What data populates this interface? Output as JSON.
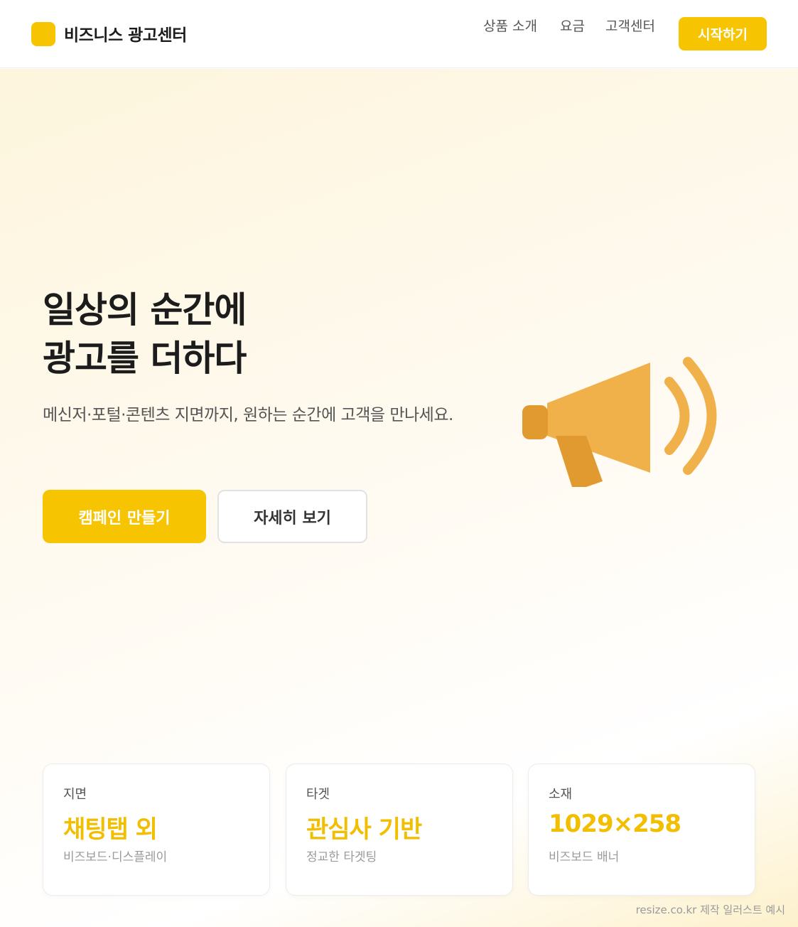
{
  "header": {
    "logo_text": "비즈니스 광고센터",
    "nav": [
      "상품 소개",
      "요금",
      "고객센터"
    ],
    "cta": "시작하기"
  },
  "hero": {
    "title_line1": "일상의 순간에",
    "title_line2": "광고를 더하다",
    "subtitle": "메신저·포털·콘텐츠 지면까지, 원하는 순간에 고객을 만나세요.",
    "primary_button": "캠페인 만들기",
    "secondary_button": "자세히 보기",
    "illustration_icon": "megaphone-icon"
  },
  "cards": [
    {
      "label": "지면",
      "value": "채팅탭 외",
      "desc": "비즈보드·디스플레이"
    },
    {
      "label": "타겟",
      "value": "관심사 기반",
      "desc": "정교한 타겟팅"
    },
    {
      "label": "소재",
      "value": "1029×258",
      "desc": "비즈보드 배너"
    }
  ],
  "footer": {
    "credit": "resize.co.kr 제작 일러스트 예시"
  },
  "colors": {
    "accent": "#f6c400",
    "accent_text": "#f2be00",
    "megaphone_light": "#f0b04a",
    "megaphone_dark": "#e09a30"
  }
}
